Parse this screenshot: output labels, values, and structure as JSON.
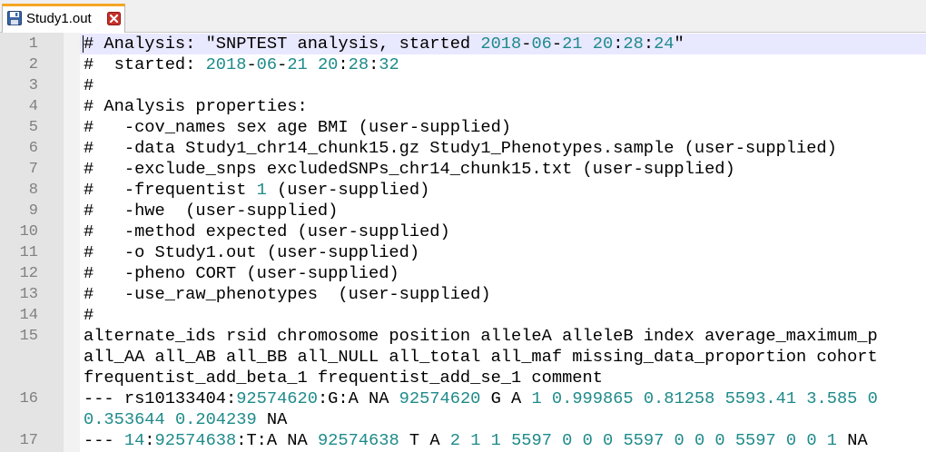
{
  "tab": {
    "title": "Study1.out"
  },
  "line_numbers": [
    "1",
    "2",
    "3",
    "4",
    "5",
    "6",
    "7",
    "8",
    "9",
    "10",
    "11",
    "12",
    "13",
    "14",
    "15",
    "16",
    "17"
  ],
  "lines": [
    {
      "num": "1",
      "segs": [
        {
          "t": "# Analysis: \"SNPTEST analysis, started "
        },
        {
          "t": "2018",
          "n": true
        },
        {
          "t": "-"
        },
        {
          "t": "06",
          "n": true
        },
        {
          "t": "-"
        },
        {
          "t": "21",
          "n": true
        },
        {
          "t": " "
        },
        {
          "t": "20",
          "n": true
        },
        {
          "t": ":"
        },
        {
          "t": "28",
          "n": true
        },
        {
          "t": ":"
        },
        {
          "t": "24",
          "n": true
        },
        {
          "t": "\""
        }
      ]
    },
    {
      "num": "2",
      "segs": [
        {
          "t": "#  started: "
        },
        {
          "t": "2018",
          "n": true
        },
        {
          "t": "-"
        },
        {
          "t": "06",
          "n": true
        },
        {
          "t": "-"
        },
        {
          "t": "21",
          "n": true
        },
        {
          "t": " "
        },
        {
          "t": "20",
          "n": true
        },
        {
          "t": ":"
        },
        {
          "t": "28",
          "n": true
        },
        {
          "t": ":"
        },
        {
          "t": "32",
          "n": true
        }
      ]
    },
    {
      "num": "3",
      "segs": [
        {
          "t": "#"
        }
      ]
    },
    {
      "num": "4",
      "segs": [
        {
          "t": "# Analysis properties:"
        }
      ]
    },
    {
      "num": "5",
      "segs": [
        {
          "t": "#   -cov_names sex age BMI (user-supplied)"
        }
      ]
    },
    {
      "num": "6",
      "segs": [
        {
          "t": "#   -data Study1_chr14_chunk15.gz Study1_Phenotypes.sample (user-supplied)"
        }
      ]
    },
    {
      "num": "7",
      "segs": [
        {
          "t": "#   -exclude_snps excludedSNPs_chr14_chunk15.txt (user-supplied)"
        }
      ]
    },
    {
      "num": "8",
      "segs": [
        {
          "t": "#   -frequentist "
        },
        {
          "t": "1",
          "n": true
        },
        {
          "t": " (user-supplied)"
        }
      ]
    },
    {
      "num": "9",
      "segs": [
        {
          "t": "#   -hwe  (user-supplied)"
        }
      ]
    },
    {
      "num": "10",
      "segs": [
        {
          "t": "#   -method expected (user-supplied)"
        }
      ]
    },
    {
      "num": "11",
      "segs": [
        {
          "t": "#   -o Study1.out (user-supplied)"
        }
      ]
    },
    {
      "num": "12",
      "segs": [
        {
          "t": "#   -pheno CORT (user-supplied)"
        }
      ]
    },
    {
      "num": "13",
      "segs": [
        {
          "t": "#   -use_raw_phenotypes  (user-supplied)"
        }
      ]
    },
    {
      "num": "14",
      "segs": [
        {
          "t": "#"
        }
      ]
    },
    {
      "num": "15",
      "segs": [
        {
          "t": "alternate_ids rsid chromosome position alleleA alleleB index average_maximum_p"
        }
      ]
    },
    {
      "num": "",
      "segs": [
        {
          "t": "all_AA all_AB all_BB all_NULL all_total all_maf missing_data_proportion cohort"
        }
      ]
    },
    {
      "num": "",
      "segs": [
        {
          "t": "frequentist_add_beta_1 frequentist_add_se_1 comment"
        }
      ]
    },
    {
      "num": "16",
      "segs": [
        {
          "t": "--- rs10133404:"
        },
        {
          "t": "92574620",
          "n": true
        },
        {
          "t": ":G:A NA "
        },
        {
          "t": "92574620",
          "n": true
        },
        {
          "t": " G A "
        },
        {
          "t": "1",
          "n": true
        },
        {
          "t": " "
        },
        {
          "t": "0.999865",
          "n": true
        },
        {
          "t": " "
        },
        {
          "t": "0.81258",
          "n": true
        },
        {
          "t": " "
        },
        {
          "t": "5593.41",
          "n": true
        },
        {
          "t": " "
        },
        {
          "t": "3.585",
          "n": true
        },
        {
          "t": " "
        },
        {
          "t": "0",
          "n": true
        }
      ]
    },
    {
      "num": "",
      "segs": [
        {
          "t": "0.353644",
          "n": true
        },
        {
          "t": " "
        },
        {
          "t": "0.204239",
          "n": true
        },
        {
          "t": " NA"
        }
      ]
    },
    {
      "num": "17",
      "segs": [
        {
          "t": "--- "
        },
        {
          "t": "14",
          "n": true
        },
        {
          "t": ":"
        },
        {
          "t": "92574638",
          "n": true
        },
        {
          "t": ":T:A NA "
        },
        {
          "t": "92574638",
          "n": true
        },
        {
          "t": " T A "
        },
        {
          "t": "2",
          "n": true
        },
        {
          "t": " "
        },
        {
          "t": "1",
          "n": true
        },
        {
          "t": " "
        },
        {
          "t": "1",
          "n": true
        },
        {
          "t": " "
        },
        {
          "t": "5597",
          "n": true
        },
        {
          "t": " "
        },
        {
          "t": "0",
          "n": true
        },
        {
          "t": " "
        },
        {
          "t": "0",
          "n": true
        },
        {
          "t": " "
        },
        {
          "t": "0",
          "n": true
        },
        {
          "t": " "
        },
        {
          "t": "5597",
          "n": true
        },
        {
          "t": " "
        },
        {
          "t": "0",
          "n": true
        },
        {
          "t": " "
        },
        {
          "t": "0",
          "n": true
        },
        {
          "t": " "
        },
        {
          "t": "0",
          "n": true
        },
        {
          "t": " "
        },
        {
          "t": "5597",
          "n": true
        },
        {
          "t": " "
        },
        {
          "t": "0",
          "n": true
        },
        {
          "t": " "
        },
        {
          "t": "0",
          "n": true
        },
        {
          "t": " "
        },
        {
          "t": "1",
          "n": true
        },
        {
          "t": " NA"
        }
      ]
    }
  ],
  "colors": {
    "number": "#1f8a8a",
    "text": "#000000",
    "line_number": "#808080",
    "gutter": "#e4e4e4",
    "current_line": "#e8e8ff"
  },
  "icons": {
    "tab_status": "save-icon",
    "tab_close": "close-icon"
  }
}
